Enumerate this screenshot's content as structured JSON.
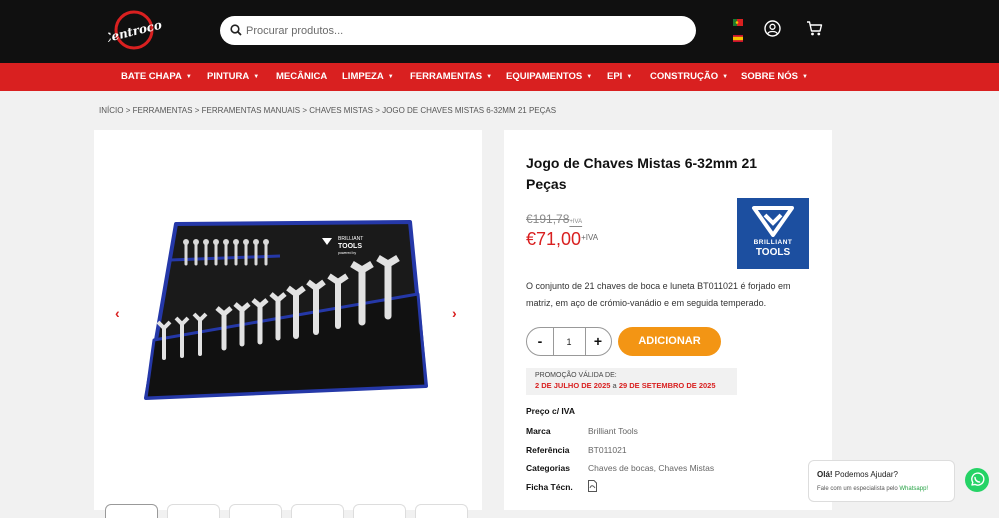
{
  "header": {
    "logo_text": "Centrocor",
    "search_placeholder": "Procurar produtos..."
  },
  "nav": [
    {
      "label": "BATE CHAPA",
      "has_caret": true
    },
    {
      "label": "PINTURA",
      "has_caret": true
    },
    {
      "label": "MECÂNICA",
      "has_caret": false
    },
    {
      "label": "LIMPEZA",
      "has_caret": true
    },
    {
      "label": "FERRAMENTAS",
      "has_caret": true
    },
    {
      "label": "EQUIPAMENTOS",
      "has_caret": true
    },
    {
      "label": "EPI",
      "has_caret": true
    },
    {
      "label": "CONSTRUÇÃO",
      "has_caret": true
    },
    {
      "label": "SOBRE NÓS",
      "has_caret": true
    }
  ],
  "breadcrumb": [
    "INÍCIO",
    "FERRAMENTAS",
    "FERRAMENTAS MANUAIS",
    "CHAVES MISTAS",
    "JOGO DE CHAVES MISTAS 6-32MM 21 PEÇAS"
  ],
  "breadcrumb_sep": ">",
  "gallery": {
    "prev_arrow": "‹",
    "next_arrow": "›",
    "pouch_brand_line1": "BRILLIANT",
    "pouch_brand_line2": "TOOLS",
    "pouch_brand_line3": "powered by"
  },
  "product": {
    "title": "Jogo de Chaves Mistas 6-32mm 21 Peças",
    "old_price": "€191,78",
    "old_price_suffix": "+IVA",
    "price": "€71,00",
    "price_suffix": "+IVA",
    "brand_logo_line1": "BRILLIANT",
    "brand_logo_line2": "TOOLS",
    "description": "O conjunto de 21 chaves de boca e luneta BT011021 é forjado em matriz, em aço de crómio-vanádio e em seguida temperado.",
    "qty_minus": "-",
    "qty_plus": "+",
    "quantity": "1",
    "add_button": "ADICIONAR",
    "promo_label": "PROMOÇÃO VÁLIDA DE:",
    "promo_start": "2 DE JULHO DE 2025",
    "promo_connector": "a",
    "promo_end": "29 DE SETEMBRO DE 2025",
    "price_with_vat_label": "Preço c/ IVA",
    "specs": [
      {
        "label": "Marca",
        "value": "Brilliant Tools"
      },
      {
        "label": "Referência",
        "value": "BT011021"
      },
      {
        "label": "Categorias",
        "value": "Chaves de bocas, Chaves Mistas"
      },
      {
        "label": "Ficha Técn.",
        "value": ""
      }
    ]
  },
  "chat": {
    "greeting_bold": "Olá!",
    "greeting_rest": "Podemos Ajudar?",
    "subtext": "Fale com um especialista pelo",
    "subtext_link": "Whatsapp!"
  },
  "colors": {
    "header_bg": "#101010",
    "nav_bg": "#d92020",
    "price": "#d92020",
    "add_button": "#f39514",
    "brand_blue": "#1c4fa0",
    "whatsapp": "#25d366"
  },
  "icons": {
    "search": "search-icon",
    "user": "user-icon",
    "cart": "cart-icon",
    "flag_pt": "portugal-flag-icon",
    "flag_es": "spain-flag-icon",
    "pdf": "file-pdf-icon",
    "whatsapp": "whatsapp-icon"
  }
}
